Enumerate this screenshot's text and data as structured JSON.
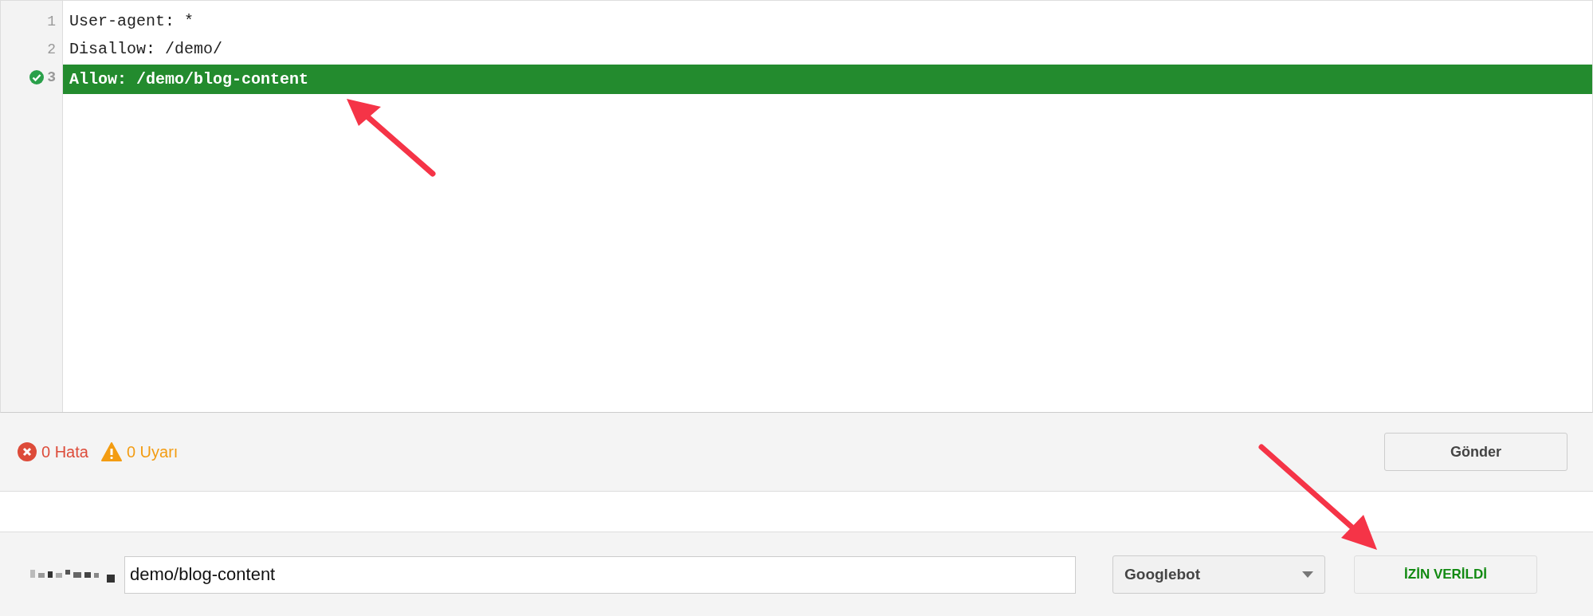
{
  "editor": {
    "lines": [
      {
        "number": "1",
        "text": "User-agent: *",
        "highlighted": false,
        "valid": false
      },
      {
        "number": "2",
        "text": "Disallow: /demo/",
        "highlighted": false,
        "valid": false
      },
      {
        "number": "3",
        "text": "Allow: /demo/blog-content",
        "highlighted": true,
        "valid": true
      }
    ]
  },
  "status_bar": {
    "errors": "0 Hata",
    "warnings": "0 Uyarı",
    "submit": "Gönder"
  },
  "test_bar": {
    "url": "demo/blog-content",
    "agent": "Googlebot",
    "result": {
      "label": "İZİN VERİLDİ",
      "kind": "allowed"
    }
  }
}
